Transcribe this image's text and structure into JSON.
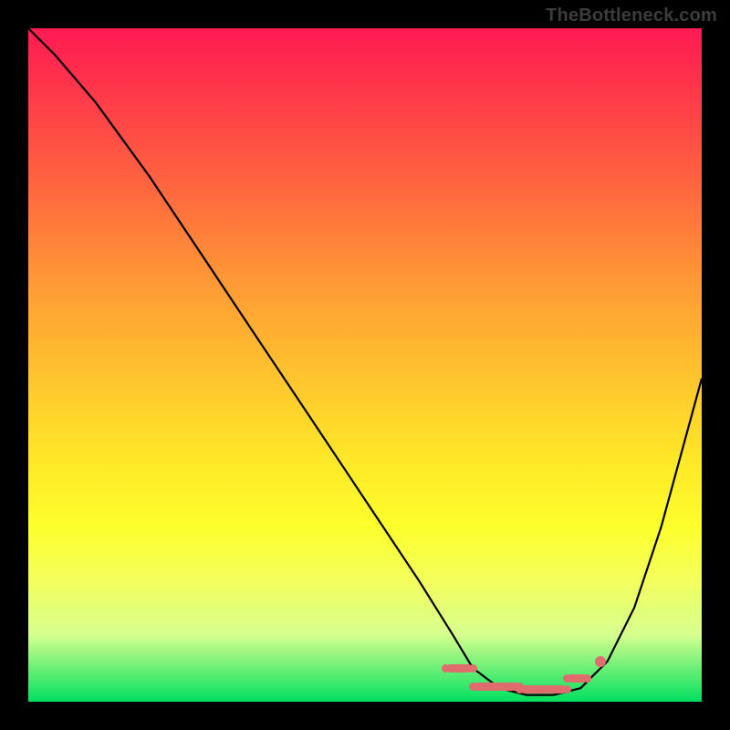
{
  "watermark": "TheBottleneck.com",
  "chart_data": {
    "type": "line",
    "title": "",
    "xlabel": "",
    "ylabel": "",
    "xlim": [
      0,
      100
    ],
    "ylim": [
      0,
      100
    ],
    "series": [
      {
        "name": "bottleneck-curve",
        "x": [
          0,
          4,
          10,
          18,
          26,
          34,
          42,
          50,
          58,
          63,
          66,
          70,
          74,
          78,
          82,
          86,
          90,
          94,
          100
        ],
        "y": [
          100,
          96,
          89,
          78,
          66,
          54,
          42,
          30,
          18,
          10,
          5,
          2,
          1,
          1,
          2,
          6,
          14,
          26,
          48
        ]
      }
    ],
    "highlight_region": {
      "name": "optimal-range",
      "segments": [
        {
          "x1": 62,
          "x2": 66,
          "y": 5
        },
        {
          "x1": 66,
          "x2": 73,
          "y": 2.2
        },
        {
          "x1": 73,
          "x2": 80,
          "y": 1.8
        },
        {
          "x1": 80,
          "x2": 83,
          "y": 3.5
        }
      ],
      "end_dot": {
        "x": 85,
        "y": 6
      }
    },
    "gradient": {
      "top": "#ff1a52",
      "bottom": "#00e060"
    }
  }
}
